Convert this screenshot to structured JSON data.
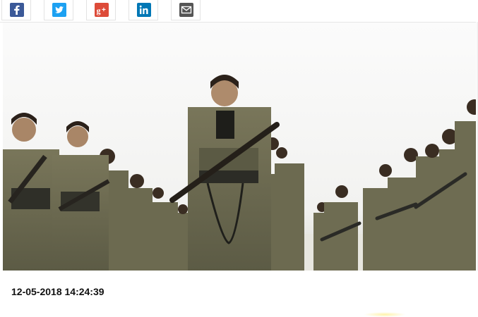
{
  "share": {
    "buttons": [
      {
        "id": "facebook",
        "icon": "facebook-icon",
        "color": "#3b5998"
      },
      {
        "id": "twitter",
        "icon": "twitter-icon",
        "color": "#1da1f2"
      },
      {
        "id": "google-plus",
        "icon": "google-plus-icon",
        "color": "#dd4b39"
      },
      {
        "id": "linkedin",
        "icon": "linkedin-icon",
        "color": "#0077b5"
      },
      {
        "id": "email",
        "icon": "envelope-icon",
        "color": "#555555"
      }
    ]
  },
  "article": {
    "timestamp": "12-05-2018 14:24:39"
  }
}
